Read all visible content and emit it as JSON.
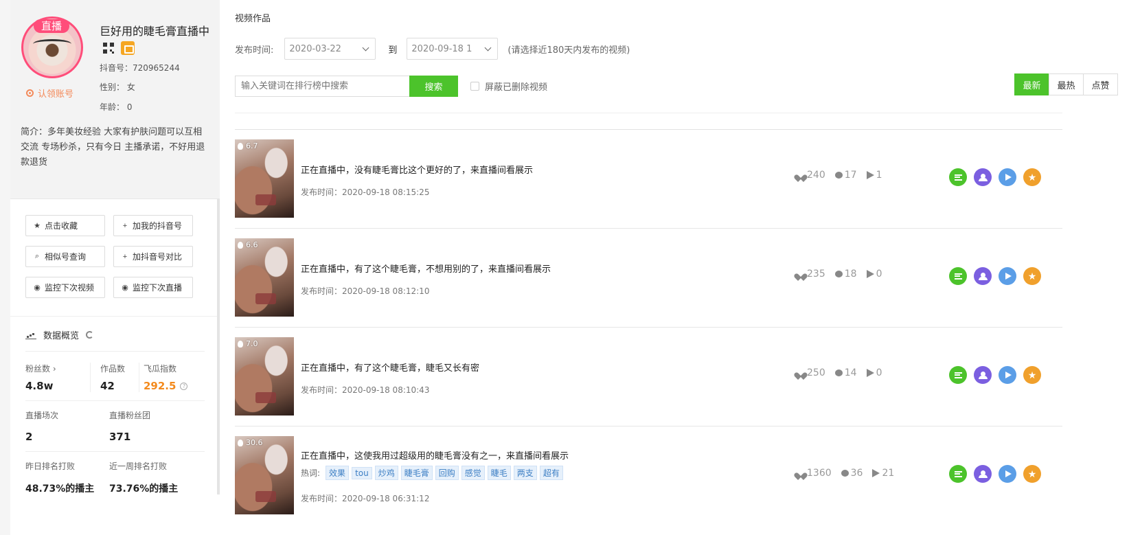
{
  "profile": {
    "live_badge": "直播",
    "claim": "认领账号",
    "nickname": "巨好用的睫毛膏直播中",
    "douyin_id": "抖音号：720965244",
    "gender": "性别：  女",
    "age": "年龄：  0",
    "bio": "简介：多年美妆经验 大家有护肤问题可以互相交流 专场秒杀，只有今日 主播承诺，不好用退款退货"
  },
  "side_buttons": {
    "favorite": "点击收藏",
    "add_mine": "加我的抖音号",
    "similar": "相似号查询",
    "compare": "加抖音号对比",
    "monitor_video": "监控下次视频",
    "monitor_live": "监控下次直播"
  },
  "overview": {
    "title": "数据概览",
    "fans_label": "粉丝数",
    "fans_value": "4.8w",
    "works_label": "作品数",
    "works_value": "42",
    "index_label": "飞瓜指数",
    "index_value": "292.5",
    "live_count_label": "直播场次",
    "live_count_value": "2",
    "fan_group_label": "直播粉丝团",
    "fan_group_value": "371",
    "yesterday_label": "昨日排名打败",
    "yesterday_value": "48.73%的播主",
    "week_label": "近一周排名打败",
    "week_value": "73.76%的播主"
  },
  "main": {
    "section_title": "视频作品",
    "filter_label": "发布时间:",
    "date_from": "2020-03-22",
    "to_label": "到",
    "date_to": "2020-09-18 1",
    "hint": "(请选择近180天内发布的视频)",
    "search_placeholder": "输入关键词在排行榜中搜索",
    "search_button": "搜索",
    "hide_deleted": "屏蔽已删除视频",
    "sort": [
      "最新",
      "最热",
      "点赞"
    ]
  },
  "videos": [
    {
      "heat": "6.7",
      "title": "正在直播中，没有睫毛膏比这个更好的了，来直播间看展示",
      "date": "发布时间：2020-09-18 08:15:25",
      "likes": "240",
      "comments": "17",
      "shares": "1"
    },
    {
      "heat": "6.6",
      "title": "正在直播中，有了这个睫毛膏，不想用别的了，来直播间看展示",
      "date": "发布时间：2020-09-18 08:12:10",
      "likes": "235",
      "comments": "18",
      "shares": "0"
    },
    {
      "heat": "7.0",
      "title": "正在直播中，有了这个睫毛膏，睫毛又长有密",
      "date": "发布时间：2020-09-18 08:10:43",
      "likes": "250",
      "comments": "14",
      "shares": "0"
    },
    {
      "heat": "30.6",
      "title": "正在直播中，这使我用过超级用的睫毛膏没有之一，来直播间看展示",
      "date": "发布时间：2020-09-18 06:31:12",
      "likes": "1360",
      "comments": "36",
      "shares": "21",
      "hot_label": "热词:",
      "tags": [
        "效果",
        "tou",
        "炒鸡",
        "睫毛膏",
        "回购",
        "感觉",
        "睫毛",
        "两支",
        "超有"
      ]
    }
  ],
  "colors": {
    "accent_green": "#4cc32b",
    "live_pink": "#ff4d7a",
    "index_orange": "#f38a1d"
  }
}
